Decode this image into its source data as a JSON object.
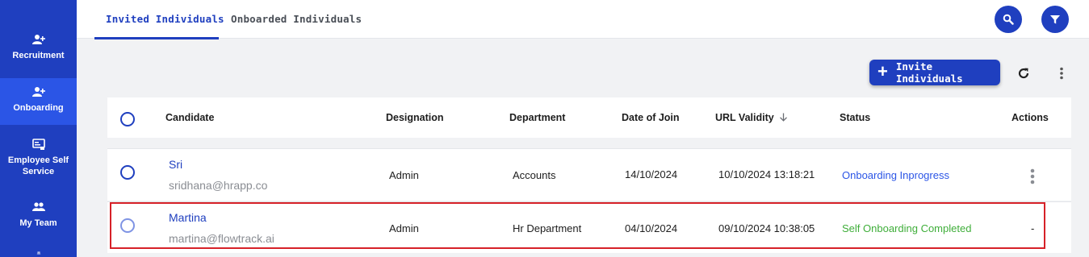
{
  "sidebar": {
    "items": [
      {
        "label": "Recruitment",
        "icon": "add-user-icon"
      },
      {
        "label": "Onboarding",
        "icon": "add-user-icon",
        "active": true
      },
      {
        "label": "Employee Self Service",
        "icon": "id-card-icon"
      },
      {
        "label": "My Team",
        "icon": "team-icon"
      },
      {
        "label": "",
        "icon": "team-icon"
      }
    ]
  },
  "tabs": [
    {
      "label": "Invited Individuals",
      "active": true
    },
    {
      "label": "Onboarded Individuals",
      "active": false
    }
  ],
  "toolbar": {
    "invite_label": "Invite Individuals"
  },
  "table": {
    "headers": {
      "candidate": "Candidate",
      "designation": "Designation",
      "department": "Department",
      "date_of_join": "Date of Join",
      "url_validity": "URL Validity",
      "status": "Status",
      "actions": "Actions"
    },
    "rows": [
      {
        "name": "Sri",
        "email": "sridhana@hrapp.co",
        "designation": "Admin",
        "department": "Accounts",
        "date_of_join": "14/10/2024",
        "url_validity": "10/10/2024 13:18:21",
        "status": "Onboarding Inprogress",
        "actions": ""
      },
      {
        "name": "Martina",
        "email": "martina@flowtrack.ai",
        "designation": "Admin",
        "department": "Hr Department",
        "date_of_join": "04/10/2024",
        "url_validity": "09/10/2024 10:38:05",
        "status": "Self Onboarding Completed",
        "actions": "-"
      }
    ]
  },
  "colors": {
    "sidebar": "#1f3fbf",
    "sidebar_active": "#2b55e6",
    "primary": "#1f3fbf",
    "status_inprogress": "#2b55e6",
    "status_completed": "#3fae3a",
    "highlight_border": "#d62128"
  }
}
